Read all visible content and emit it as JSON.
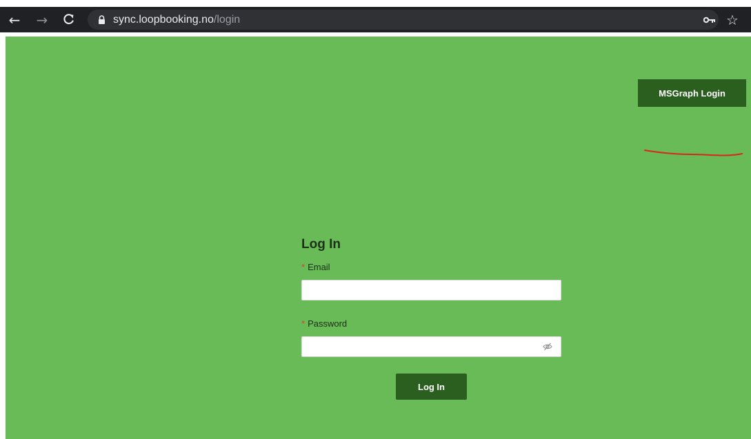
{
  "browser": {
    "url_host": "sync.loopbooking.no",
    "url_path": "/login"
  },
  "header": {
    "msgraph_button_label": "MSGraph Login",
    "annotation_color": "#d8261b"
  },
  "login_form": {
    "title": "Log In",
    "required_mark": "*",
    "email_label": "Email",
    "email_value": "",
    "password_label": "Password",
    "password_value": "",
    "submit_label": "Log In"
  },
  "colors": {
    "page_background": "#68bb56",
    "button_background": "#2a5f1f",
    "required_mark": "#e23b3b"
  },
  "icons": {
    "back": "arrow-left",
    "forward": "arrow-right",
    "reload": "reload",
    "lock": "padlock",
    "key": "key",
    "bookmark": "star-outline",
    "password_toggle": "eye-slash"
  }
}
